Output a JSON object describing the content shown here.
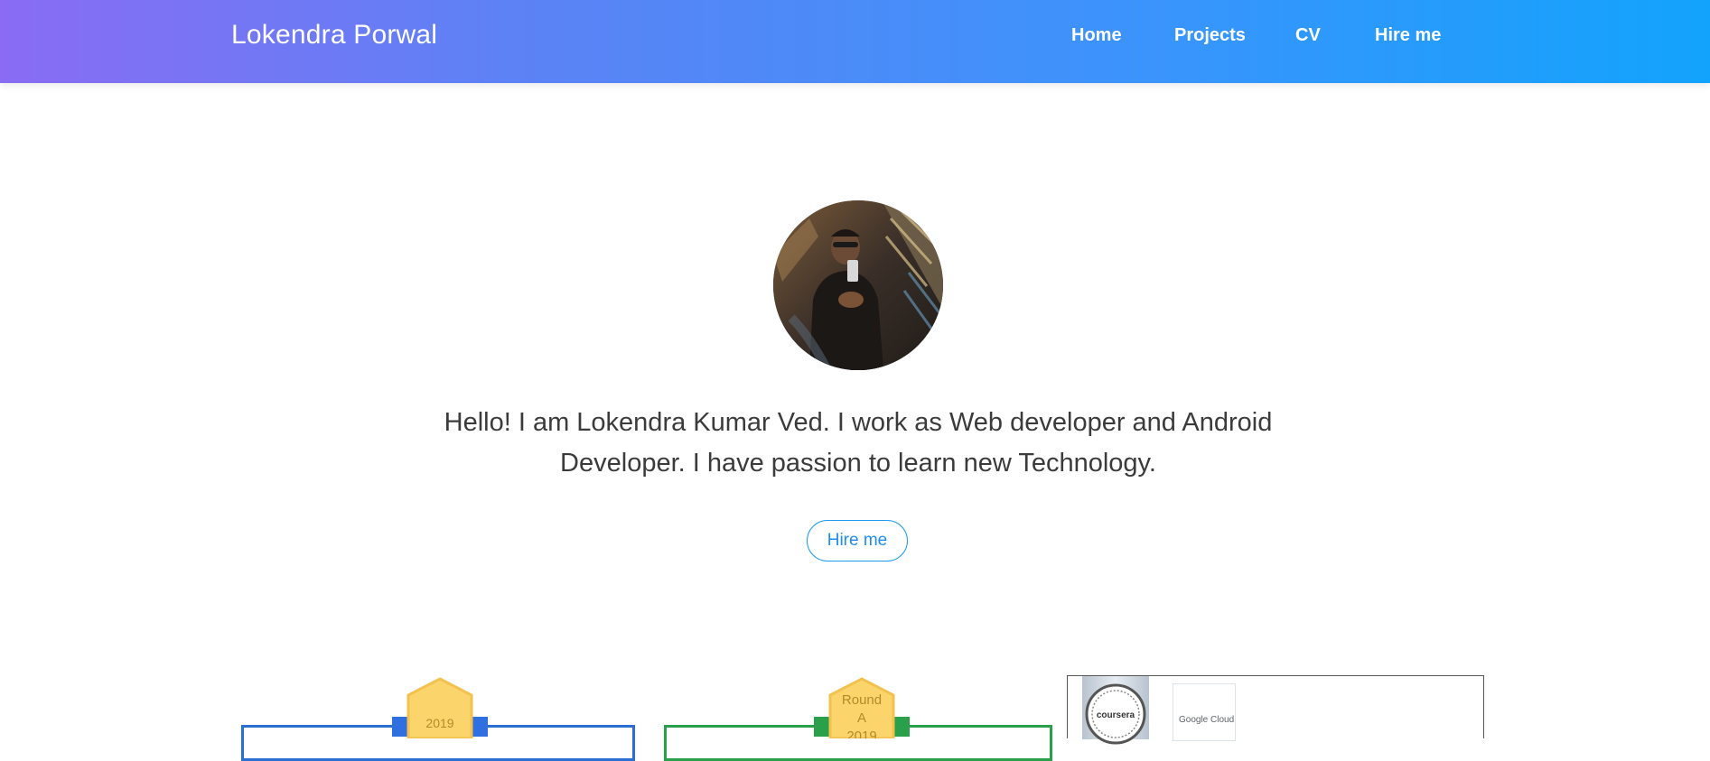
{
  "navbar": {
    "brand": "Lokendra Porwal",
    "links": [
      "Home",
      "Projects",
      "CV",
      "Hire me"
    ]
  },
  "hero": {
    "avatar_alt": "profile photo",
    "intro_line1": "Hello! I am Lokendra Kumar Ved. I work as Web developer and Android",
    "intro_line2": "Developer. I have passion to learn new Technology.",
    "cta_label": "Hire me"
  },
  "certificates": [
    {
      "badge_text": "2019",
      "frame_color": "#2a6fd1",
      "ribbon_color": "#2f6fe0"
    },
    {
      "badge_line1": "Round",
      "badge_line2": "A",
      "badge_line3": "2019",
      "frame_color": "#2aa04a",
      "ribbon_color": "#2aa04a"
    },
    {
      "seal_text": "coursera",
      "partner_text": "Google Cloud"
    }
  ],
  "colors": {
    "gradient_start": "#8a6cf4",
    "gradient_end": "#12a3fd",
    "accent": "#1d9bf0"
  }
}
